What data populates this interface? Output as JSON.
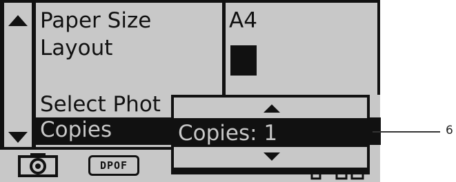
{
  "menu": {
    "items": [
      {
        "label": "Paper Size"
      },
      {
        "label": "Layout"
      },
      {
        "label": "Select Phot"
      },
      {
        "label": "Copies"
      }
    ]
  },
  "settings": {
    "paper_size_value": "A4"
  },
  "popup": {
    "value_text": "Copies: 1"
  },
  "bottom_bar": {
    "dpof_label": "DPOF"
  },
  "callout": {
    "label": "6"
  },
  "icons": [
    "camera-icon",
    "dpof-icon",
    "scroll-up-icon",
    "scroll-down-icon",
    "popup-up-arrow-icon",
    "popup-down-arrow-icon"
  ]
}
